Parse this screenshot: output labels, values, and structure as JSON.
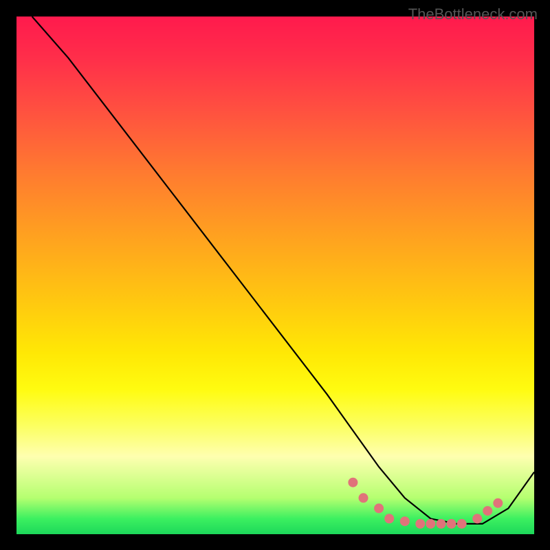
{
  "watermark": "TheBottleneck.com",
  "chart_data": {
    "type": "line",
    "title": "",
    "xlabel": "",
    "ylabel": "",
    "xlim": [
      0,
      100
    ],
    "ylim": [
      0,
      100
    ],
    "series": [
      {
        "name": "curve",
        "x": [
          3,
          10,
          20,
          30,
          40,
          50,
          60,
          65,
          70,
          75,
          80,
          85,
          90,
          95,
          100
        ],
        "y": [
          100,
          92,
          79,
          66,
          53,
          40,
          27,
          20,
          13,
          7,
          3,
          2,
          2,
          5,
          12
        ]
      }
    ],
    "highlight_points": {
      "name": "marked-region",
      "color": "#e0737a",
      "x": [
        65,
        67,
        70,
        72,
        75,
        78,
        80,
        82,
        84,
        86,
        89,
        91,
        93
      ],
      "y": [
        10,
        7,
        5,
        3,
        2.5,
        2,
        2,
        2,
        2,
        2,
        3,
        4.5,
        6
      ]
    }
  }
}
